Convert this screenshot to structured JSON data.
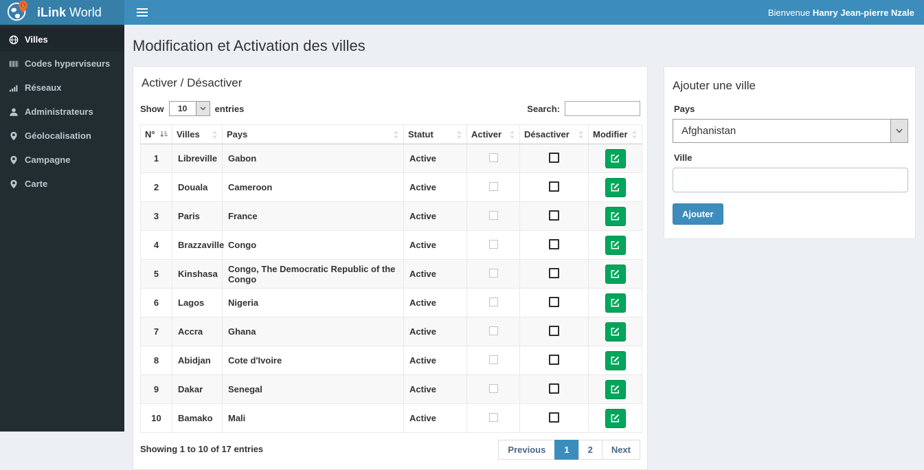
{
  "brand": {
    "name_bold": "iLink",
    "name_light": "World"
  },
  "header": {
    "welcome_prefix": "Bienvenue ",
    "user_name": "Hanry Jean-pierre Nzale"
  },
  "sidebar": {
    "items": [
      {
        "label": "Villes",
        "icon": "globe-icon",
        "active": true
      },
      {
        "label": "Codes hyperviseurs",
        "icon": "barcode-icon",
        "active": false
      },
      {
        "label": "Réseaux",
        "icon": "signal-bars-icon",
        "active": false
      },
      {
        "label": "Administrateurs",
        "icon": "user-icon",
        "active": false
      },
      {
        "label": "Géolocalisation",
        "icon": "map-marker-icon",
        "active": false
      },
      {
        "label": "Campagne",
        "icon": "map-marker-icon",
        "active": false
      },
      {
        "label": "Carte",
        "icon": "map-marker-icon",
        "active": false
      }
    ]
  },
  "page": {
    "title": "Modification et Activation des villes"
  },
  "panel": {
    "title": "Activer / Désactiver",
    "length_before": "Show",
    "length_value": "10",
    "length_after": "entries",
    "search_label": "Search:",
    "search_value": "",
    "table": {
      "headers": [
        "N°",
        "Villes",
        "Pays",
        "Statut",
        "Activer",
        "Désactiver",
        "Modifier"
      ],
      "rows": [
        {
          "num": "1",
          "ville": "Libreville",
          "pays": "Gabon",
          "statut": "Active"
        },
        {
          "num": "2",
          "ville": "Douala",
          "pays": "Cameroon",
          "statut": "Active"
        },
        {
          "num": "3",
          "ville": "Paris",
          "pays": "France",
          "statut": "Active"
        },
        {
          "num": "4",
          "ville": "Brazzaville",
          "pays": "Congo",
          "statut": "Active"
        },
        {
          "num": "5",
          "ville": "Kinshasa",
          "pays": "Congo, The Democratic Republic of the Congo",
          "statut": "Active"
        },
        {
          "num": "6",
          "ville": "Lagos",
          "pays": "Nigeria",
          "statut": "Active"
        },
        {
          "num": "7",
          "ville": "Accra",
          "pays": "Ghana",
          "statut": "Active"
        },
        {
          "num": "8",
          "ville": "Abidjan",
          "pays": "Cote d'Ivoire",
          "statut": "Active"
        },
        {
          "num": "9",
          "ville": "Dakar",
          "pays": "Senegal",
          "statut": "Active"
        },
        {
          "num": "10",
          "ville": "Bamako",
          "pays": "Mali",
          "statut": "Active"
        }
      ]
    },
    "footer": {
      "info": "Showing 1 to 10 of 17 entries",
      "pagination": [
        "Previous",
        "1",
        "2",
        "Next"
      ],
      "active_page": "1"
    }
  },
  "add_panel": {
    "title": "Ajouter une ville",
    "pays_label": "Pays",
    "pays_value": "Afghanistan",
    "ville_label": "Ville",
    "ville_value": "",
    "submit_label": "Ajouter"
  },
  "colors": {
    "navbar_blue": "#3c8dbc",
    "logo_blue": "#367fa9",
    "sidebar_dark": "#222d32",
    "sidebar_active": "#1e282c",
    "edit_green": "#00a65a",
    "pin_orange": "#ed6a2e",
    "body_bg": "#ecf0f5"
  }
}
